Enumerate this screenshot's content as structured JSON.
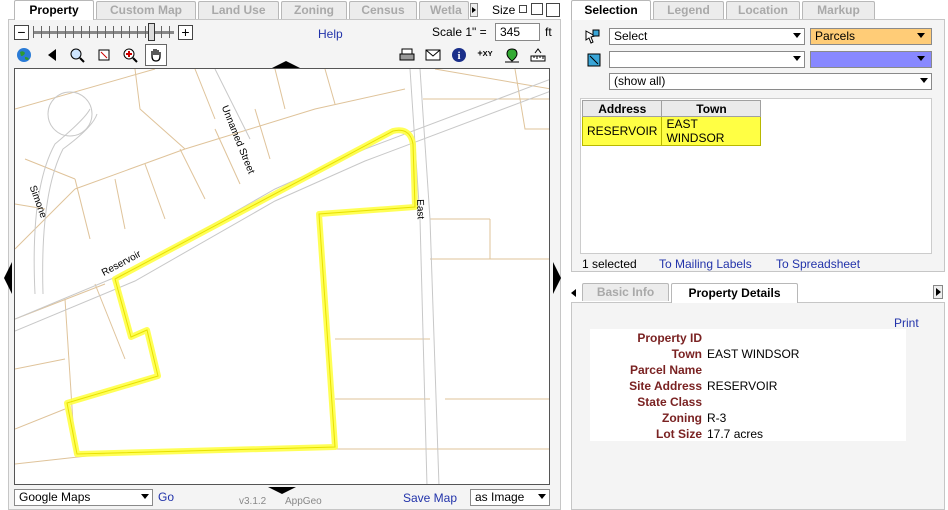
{
  "left_tabs": [
    "Property",
    "Custom Map",
    "Land Use",
    "Zoning",
    "Census",
    "Wetla"
  ],
  "size_label": "Size",
  "help": "Help",
  "scale": {
    "label": "Scale 1\" =",
    "value": "345",
    "unit": "ft"
  },
  "map": {
    "streets": [
      "Unnamed Street",
      "Simone",
      "Reservoir",
      "East"
    ]
  },
  "basemap": {
    "selected": "Google Maps",
    "go": "Go"
  },
  "version": "v3.1.2",
  "brand": "AppGeo",
  "save_map": "Save Map",
  "save_format": "as Image",
  "right_tabs": [
    "Selection",
    "Legend",
    "Location",
    "Markup"
  ],
  "selection": {
    "action": "Select",
    "layer": "Parcels",
    "filter": "(show all)",
    "headers": [
      "Address",
      "Town"
    ],
    "rows": [
      [
        "RESERVOIR",
        "EAST WINDSOR"
      ]
    ],
    "count": "1 selected",
    "mailing": "To Mailing Labels",
    "spreadsheet": "To Spreadsheet"
  },
  "info_tabs": [
    "Basic Info",
    "Property Details"
  ],
  "details": {
    "print": "Print",
    "fields": [
      {
        "k": "Property ID",
        "v": ""
      },
      {
        "k": "Town",
        "v": "EAST WINDSOR"
      },
      {
        "k": "Parcel Name",
        "v": ""
      },
      {
        "k": "Site Address",
        "v": "RESERVOIR"
      },
      {
        "k": "State Class",
        "v": ""
      },
      {
        "k": "Zoning",
        "v": "R-3"
      },
      {
        "k": "Lot Size",
        "v": "17.7 acres"
      }
    ]
  },
  "colors": {
    "parcel_highlight": "#ffff44",
    "layer_parcels": "#ffcc77",
    "layer_blue": "#8888ff",
    "link": "#2233aa"
  }
}
